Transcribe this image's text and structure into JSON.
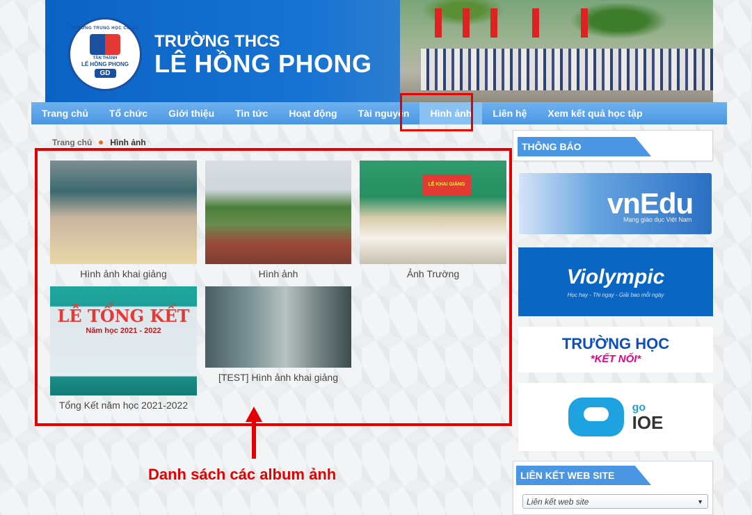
{
  "header": {
    "logo_ring_text": "TRƯỜNG TRUNG HỌC CƠ SỞ",
    "logo_town": "TÂN THÀNH",
    "logo_school": "LÊ HỒNG PHONG",
    "logo_gd": "GD",
    "school_type": "TRƯỜNG THCS",
    "school_name": "LÊ HỒNG PHONG"
  },
  "nav": {
    "items": [
      "Trang chủ",
      "Tổ chức",
      "Giới thiệu",
      "Tin tức",
      "Hoạt động",
      "Tài nguyên",
      "Hình ảnh",
      "Liên hệ",
      "Xem kết quả học tập"
    ],
    "active": "Hình ảnh"
  },
  "breadcrumb": {
    "home": "Trang chủ",
    "current": "Hình ảnh"
  },
  "albums": [
    {
      "title": "Hình ảnh khai giảng"
    },
    {
      "title": "Hình ảnh"
    },
    {
      "title": "Ảnh Trường",
      "sign": "LỄ KHAI GIẢNG"
    },
    {
      "title": "Tổng Kết năm học 2021-2022",
      "banner": "LỄ TỔNG KẾT",
      "banner_year": "Năm học 2021 - 2022"
    },
    {
      "title": "[TEST] Hình ảnh khai giảng"
    }
  ],
  "annotation": {
    "text": "Danh sách các album ảnh"
  },
  "sidebar": {
    "notice_title": "THÔNG BÁO",
    "ads": {
      "vnedu": "vnEdu",
      "vnedu_sub": "Mạng giáo dục Việt Nam",
      "violympic": "Violympic",
      "violympic_sub": "Học hay - Thi ngay - Giải bao mỗi ngày",
      "thkn_top": "TRƯỜNG HỌC",
      "thkn_bottom": "*KẾT NỐI*",
      "ioe_go": "go",
      "ioe": "IOE"
    },
    "links_title": "LIÊN KẾT WEB SITE",
    "links_select": "Liên kết web site"
  },
  "colors": {
    "accent": "#4b96e2",
    "highlight": "#e30000"
  }
}
